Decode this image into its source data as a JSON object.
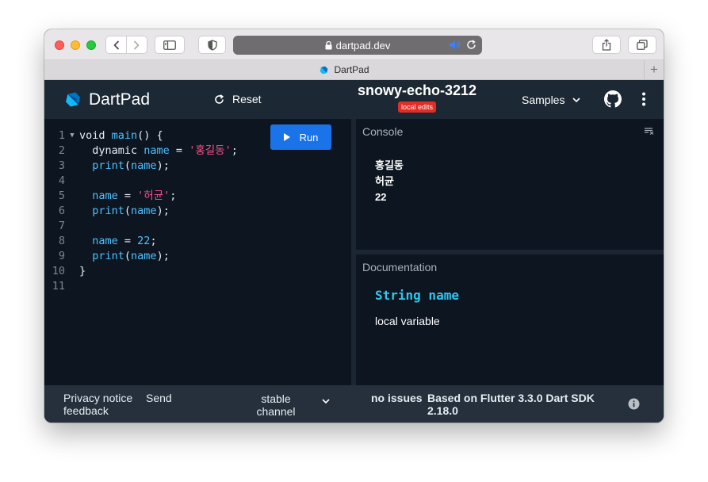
{
  "browser": {
    "url": "dartpad.dev",
    "tab_title": "DartPad",
    "new_tab_label": "+"
  },
  "header": {
    "logo_text": "DartPad",
    "reset_label": "Reset",
    "pad_title": "snowy-echo-3212",
    "badge": "local edits",
    "samples_label": "Samples"
  },
  "editor": {
    "run_label": "Run",
    "lines": [
      {
        "n": "1",
        "fold": true,
        "tokens": [
          {
            "t": "void ",
            "c": "kw-type"
          },
          {
            "t": "main",
            "c": "fn"
          },
          {
            "t": "() {",
            "c": "src"
          }
        ]
      },
      {
        "n": "2",
        "tokens": [
          {
            "t": "  dynamic ",
            "c": "kw-type"
          },
          {
            "t": "name",
            "c": "var"
          },
          {
            "t": " = ",
            "c": "src"
          },
          {
            "t": "'홍길동'",
            "c": "str"
          },
          {
            "t": ";",
            "c": "src"
          }
        ]
      },
      {
        "n": "3",
        "tokens": [
          {
            "t": "  ",
            "c": "src"
          },
          {
            "t": "print",
            "c": "fn"
          },
          {
            "t": "(",
            "c": "src"
          },
          {
            "t": "name",
            "c": "var"
          },
          {
            "t": ");",
            "c": "src"
          }
        ]
      },
      {
        "n": "4",
        "tokens": []
      },
      {
        "n": "5",
        "tokens": [
          {
            "t": "  ",
            "c": "src"
          },
          {
            "t": "name",
            "c": "var"
          },
          {
            "t": " = ",
            "c": "src"
          },
          {
            "t": "'허균'",
            "c": "str"
          },
          {
            "t": ";",
            "c": "src"
          }
        ]
      },
      {
        "n": "6",
        "tokens": [
          {
            "t": "  ",
            "c": "src"
          },
          {
            "t": "print",
            "c": "fn"
          },
          {
            "t": "(",
            "c": "src"
          },
          {
            "t": "name",
            "c": "var"
          },
          {
            "t": ");",
            "c": "src"
          }
        ]
      },
      {
        "n": "7",
        "tokens": []
      },
      {
        "n": "8",
        "tokens": [
          {
            "t": "  ",
            "c": "src"
          },
          {
            "t": "name",
            "c": "var"
          },
          {
            "t": " = ",
            "c": "src"
          },
          {
            "t": "22",
            "c": "fn"
          },
          {
            "t": ";",
            "c": "src"
          }
        ]
      },
      {
        "n": "9",
        "tokens": [
          {
            "t": "  ",
            "c": "src"
          },
          {
            "t": "print",
            "c": "fn"
          },
          {
            "t": "(",
            "c": "src"
          },
          {
            "t": "name",
            "c": "var"
          },
          {
            "t": ");",
            "c": "src"
          }
        ]
      },
      {
        "n": "10",
        "tokens": [
          {
            "t": "}",
            "c": "src"
          }
        ]
      },
      {
        "n": "11",
        "tokens": []
      }
    ]
  },
  "console": {
    "label": "Console",
    "output": [
      "홍길동",
      "허균",
      "22"
    ]
  },
  "docs": {
    "label": "Documentation",
    "signature": "String name",
    "description": "local variable"
  },
  "footer": {
    "privacy": "Privacy notice",
    "send": "Send",
    "feedback": "feedback",
    "channel": "stable channel",
    "issues": "no issues",
    "version": "Based on Flutter 3.3.0 Dart SDK 2.18.0"
  },
  "colors": {
    "background": "#0d1520",
    "header": "#1c2834",
    "footer": "#25303c",
    "run_button": "#1a73e8",
    "badge": "#e32d24",
    "string": "#ff4f8b",
    "identifier": "#4fc1ff"
  },
  "icons": [
    "back-icon",
    "forward-icon",
    "sidebar-icon",
    "shield-icon",
    "lock-icon",
    "audio-icon",
    "reload-icon",
    "share-icon",
    "tabs-icon",
    "dart-logo-icon",
    "reset-icon",
    "chevron-down-icon",
    "github-icon",
    "more-vert-icon",
    "play-icon",
    "clear-console-icon",
    "info-icon"
  ]
}
